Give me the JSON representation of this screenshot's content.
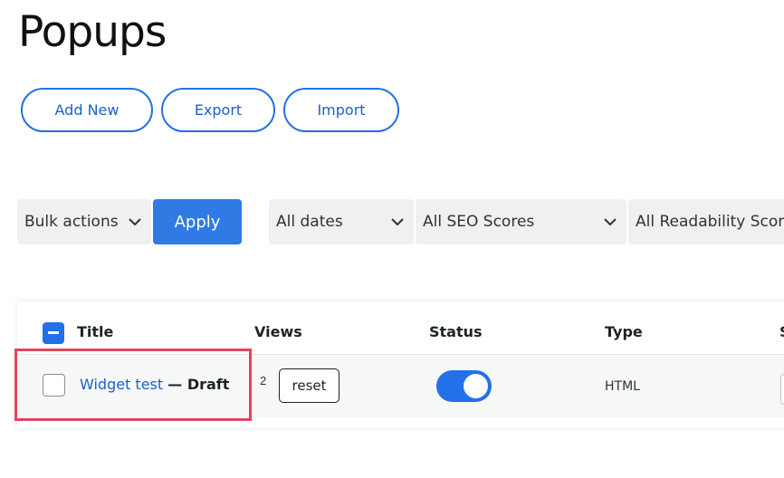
{
  "page": {
    "title": "Popups"
  },
  "actions": {
    "add_new": "Add New",
    "export": "Export",
    "import": "Import"
  },
  "filters": {
    "bulk_actions": "Bulk actions",
    "apply": "Apply",
    "dates": "All dates",
    "seo_scores": "All SEO Scores",
    "readability_scores": "All Readability Scores"
  },
  "table": {
    "columns": {
      "title": "Title",
      "views": "Views",
      "status": "Status",
      "type": "Type",
      "next": "S"
    },
    "rows": [
      {
        "title": "Widget test",
        "state": "— Draft",
        "views": "2",
        "reset": "reset",
        "status_on": true,
        "type": "HTML"
      }
    ]
  },
  "colors": {
    "accent": "#2271e8",
    "highlight": "#e2445c"
  }
}
